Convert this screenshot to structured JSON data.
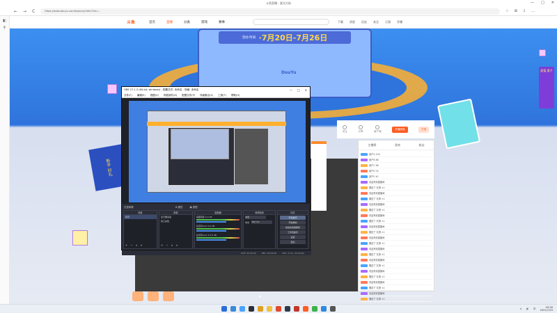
{
  "browser": {
    "window_title": "斗鱼直播 - 星光大街",
    "url": "https://www.douyu.com/topic/xy2bhc?rid=...",
    "nav": {
      "back": "←",
      "forward": "→",
      "reload": "C",
      "home": "⌂"
    },
    "tools": [
      "☆",
      "⊞",
      "⇩",
      "…"
    ],
    "win_controls": [
      "—",
      "□",
      "✕"
    ],
    "side_icons": [
      "◧",
      "⚲"
    ]
  },
  "douyu": {
    "logo": "斗鱼",
    "menu": [
      {
        "label": "首页",
        "active": false
      },
      {
        "label": "直播",
        "active": true
      },
      {
        "label": "分类",
        "active": false
      },
      {
        "label": "游戏",
        "active": false
      },
      {
        "label": "赛事",
        "active": false
      }
    ],
    "header_icons": [
      "下载",
      "消息",
      "历史",
      "关注",
      "订阅",
      "开播"
    ]
  },
  "banner": {
    "date_small": "活动 时间",
    "date_big": "·7月20日-7月26日",
    "brand": "DouYu",
    "side_promo": "超值 惠子",
    "card_left": "新手 好礼"
  },
  "room_top": {
    "items": [
      "关注",
      "分享",
      "客户端"
    ],
    "btn_primary": "开通贵族",
    "btn_secondary": "打赏"
  },
  "chat_panel": {
    "tabs": [
      "主播榜",
      "贵宾",
      "粉丝"
    ],
    "rows": [
      {
        "level": "blue",
        "text": "用户A 100"
      },
      {
        "level": "purple",
        "text": "用户B 88"
      },
      {
        "level": "orange",
        "text": "用户C 66"
      },
      {
        "level": "red",
        "text": "用户D 52"
      },
      {
        "level": "blue",
        "text": "用户E 40"
      },
      {
        "level": "purple",
        "text": "欢迎来到直播间"
      },
      {
        "level": "orange",
        "text": "赠送了 礼物 ×1"
      },
      {
        "level": "red",
        "text": "欢迎来到直播间"
      },
      {
        "level": "blue",
        "text": "赠送了 礼物 ×1"
      },
      {
        "level": "purple",
        "text": "欢迎来到直播间"
      },
      {
        "level": "orange",
        "text": "赠送了 礼物 ×1"
      },
      {
        "level": "red",
        "text": "欢迎来到直播间"
      },
      {
        "level": "blue",
        "text": "赠送了 礼物 ×1"
      },
      {
        "level": "purple",
        "text": "欢迎来到直播间"
      },
      {
        "level": "orange",
        "text": "赠送了 礼物 ×1"
      },
      {
        "level": "red",
        "text": "欢迎来到直播间"
      },
      {
        "level": "blue",
        "text": "赠送了 礼物 ×1"
      },
      {
        "level": "purple",
        "text": "欢迎来到直播间"
      },
      {
        "level": "orange",
        "text": "赠送了 礼物 ×1"
      },
      {
        "level": "red",
        "text": "欢迎来到直播间"
      },
      {
        "level": "blue",
        "text": "赠送了 礼物 ×1"
      },
      {
        "level": "purple",
        "text": "欢迎来到直播间"
      },
      {
        "level": "orange",
        "text": "赠送了 礼物 ×1"
      },
      {
        "level": "red",
        "text": "欢迎来到直播间"
      },
      {
        "level": "blue",
        "text": "赠送了 礼物 ×1"
      },
      {
        "level": "purple",
        "text": "欢迎来到直播间"
      },
      {
        "level": "orange",
        "text": "赠送了 礼物 ×1"
      }
    ]
  },
  "obs": {
    "title": "OBS 27.1.3 (64-bit, windows) - 配置文件: 未命名 - 场景: 未命名",
    "menu": [
      "文件(F)",
      "编辑(E)",
      "视图(V)",
      "停靠部件(D)",
      "配置文件(P)",
      "场景集合(S)",
      "工具(T)",
      "帮助(H)"
    ],
    "win_controls": [
      "—",
      "□",
      "✕"
    ],
    "toolbar_left": "无选择源",
    "toolbar_mid": [
      "⚙ 属性",
      "▣ 滤镜"
    ],
    "scenes": {
      "header": "场景",
      "items": [
        "场景"
      ]
    },
    "sources": {
      "header": "来源",
      "items": [
        "显示器采集",
        "窗口采集"
      ]
    },
    "mixer": {
      "header": "混音器",
      "tracks": [
        {
          "name": "桌面音频",
          "db": "0.0 dB"
        },
        {
          "name": "麦克风/Aux",
          "db": "0.0 dB"
        },
        {
          "name": "麦克风/Aux 2",
          "db": "0.0 dB"
        }
      ]
    },
    "transitions": {
      "header": "转场特效",
      "type": "淡出",
      "duration_label": "时长",
      "duration": "300 ms"
    },
    "controls": {
      "header": "控件",
      "buttons": [
        "开始推流",
        "开始录制",
        "启动虚拟摄像机",
        "工作室模式",
        "设置",
        "退出"
      ]
    },
    "status": [
      "LIVE: 00:00:00",
      "REC: 00:00:00",
      "CPU: 3.1%, 30.00 fps"
    ],
    "dock_footer": [
      "+",
      "−",
      "∧",
      "∨"
    ]
  },
  "taskbar": {
    "clock_time": "20:30",
    "clock_date": "2021/7/25",
    "tray": [
      "∧",
      "🔊",
      "中"
    ],
    "app_colors": [
      "#2a6ed8",
      "#3a8ad8",
      "#4aa3ff",
      "#2b2e38",
      "#e0a020",
      "#f0c040",
      "#e04a2e",
      "#2e3a4a",
      "#c0392b",
      "#ff5d23",
      "#3bb34a",
      "#2e88e0",
      "#555"
    ]
  },
  "colors": {
    "douyu_orange": "#ff5d23",
    "banner_blue": "#2f74dc",
    "obs_bg": "#2b2e38"
  }
}
